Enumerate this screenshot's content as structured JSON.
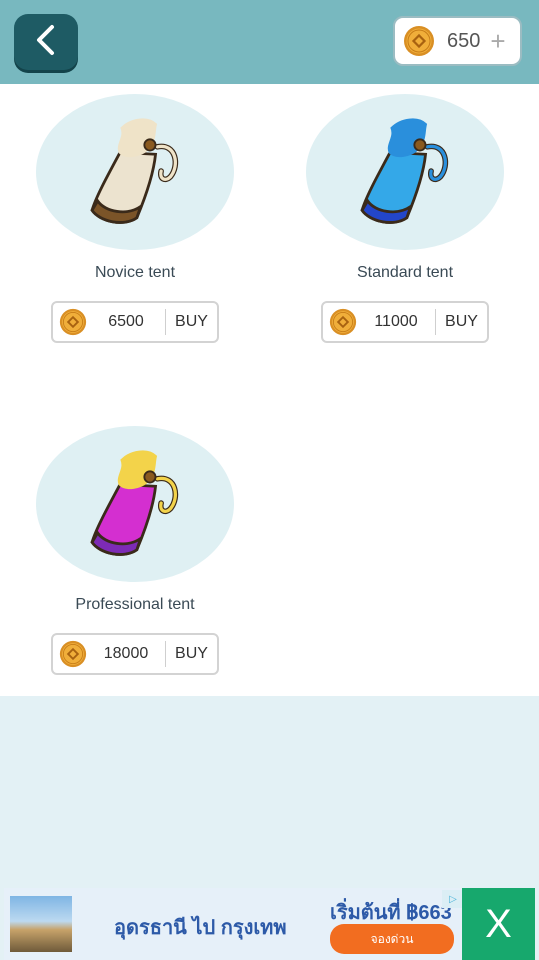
{
  "header": {
    "coins": "650",
    "plus_label": "+"
  },
  "items": [
    {
      "name": "Novice tent",
      "price": "6500",
      "buy_label": "BUY",
      "colors": {
        "body": "#ece3cf",
        "band": "#7b5428",
        "tie": "#efe3c8"
      }
    },
    {
      "name": "Standard tent",
      "price": "11000",
      "buy_label": "BUY",
      "colors": {
        "body": "#34a8e8",
        "band": "#2346c9",
        "tie": "#2a8fdc"
      }
    },
    {
      "name": "Professional tent",
      "price": "18000",
      "buy_label": "BUY",
      "colors": {
        "body": "#d42fd0",
        "band": "#7d2bb5",
        "tie": "#f3d34a"
      }
    }
  ],
  "ad": {
    "title": "อุดรธานี ไป กรุงเทพ",
    "price": "เริ่มต้นที่ ฿663",
    "book_label": "จองด่วน",
    "ad_marker": "▷",
    "close_label": "X"
  },
  "colors": {
    "header_bg": "#78b8bf",
    "back_button": "#1e5b64",
    "coin_gold": "#e8a432",
    "page_bg": "#e3f1f5",
    "ad_close": "#17a86d"
  }
}
